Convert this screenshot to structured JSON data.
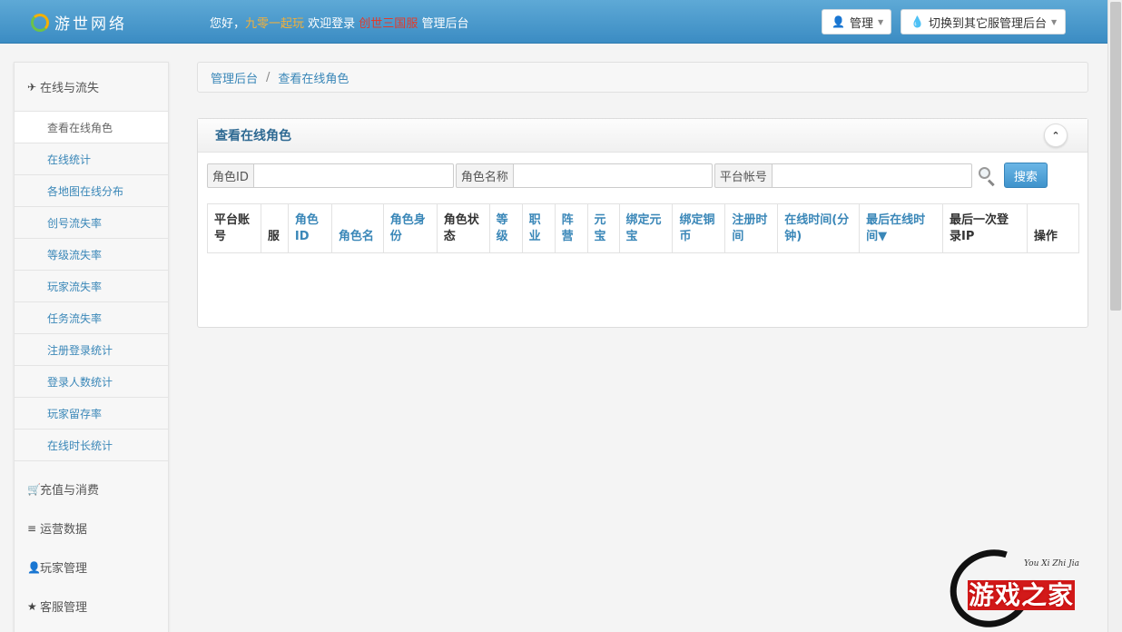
{
  "header": {
    "logo_text": "游世网络",
    "welcome_prefix": "您好，",
    "username": "九零一起玩",
    "welcome_mid": " 欢迎登录 ",
    "server_name": "创世三国",
    "server_suffix": "服",
    "welcome_end": " 管理后台",
    "admin_button": "管理",
    "switch_button": "切换到其它服管理后台"
  },
  "sidebar": {
    "group_online": "在线与流失",
    "items": [
      {
        "label": "查看在线角色",
        "active": true
      },
      {
        "label": "在线统计"
      },
      {
        "label": "各地图在线分布"
      },
      {
        "label": "创号流失率"
      },
      {
        "label": "等级流失率"
      },
      {
        "label": "玩家流失率"
      },
      {
        "label": "任务流失率"
      },
      {
        "label": "注册登录统计"
      },
      {
        "label": "登录人数统计"
      },
      {
        "label": "玩家留存率"
      },
      {
        "label": "在线时长统计"
      }
    ],
    "group_recharge": "充值与消费",
    "group_operations": "运营数据",
    "group_players": "玩家管理",
    "group_service": "客服管理"
  },
  "breadcrumb": {
    "root": "管理后台",
    "separator": "/",
    "current": "查看在线角色"
  },
  "panel": {
    "title": "查看在线角色",
    "filters": {
      "role_id_label": "角色ID",
      "role_id_value": "",
      "role_name_label": "角色名称",
      "role_name_value": "",
      "account_label": "平台帐号",
      "account_value": "",
      "search_button": "搜索"
    },
    "columns": [
      {
        "label": "平台账号",
        "sortable": false
      },
      {
        "label": "服",
        "sortable": false
      },
      {
        "label": "角色ID",
        "sortable": true
      },
      {
        "label": "角色名",
        "sortable": true
      },
      {
        "label": "角色身份",
        "sortable": true
      },
      {
        "label": "角色状态",
        "sortable": false
      },
      {
        "label": "等级",
        "sortable": true
      },
      {
        "label": "职业",
        "sortable": true
      },
      {
        "label": "阵营",
        "sortable": true
      },
      {
        "label": "元宝",
        "sortable": true
      },
      {
        "label": "绑定元宝",
        "sortable": true
      },
      {
        "label": "绑定铜币",
        "sortable": true
      },
      {
        "label": "注册时间",
        "sortable": true
      },
      {
        "label": "在线时间(分钟)",
        "sortable": true
      },
      {
        "label": "最后在线时间▼",
        "sortable": true
      },
      {
        "label": "最后一次登录IP",
        "sortable": false
      },
      {
        "label": "操作",
        "sortable": false
      }
    ],
    "rows": []
  },
  "watermark": {
    "cn": "游戏之家",
    "en": "You Xi Zhi Jia"
  }
}
